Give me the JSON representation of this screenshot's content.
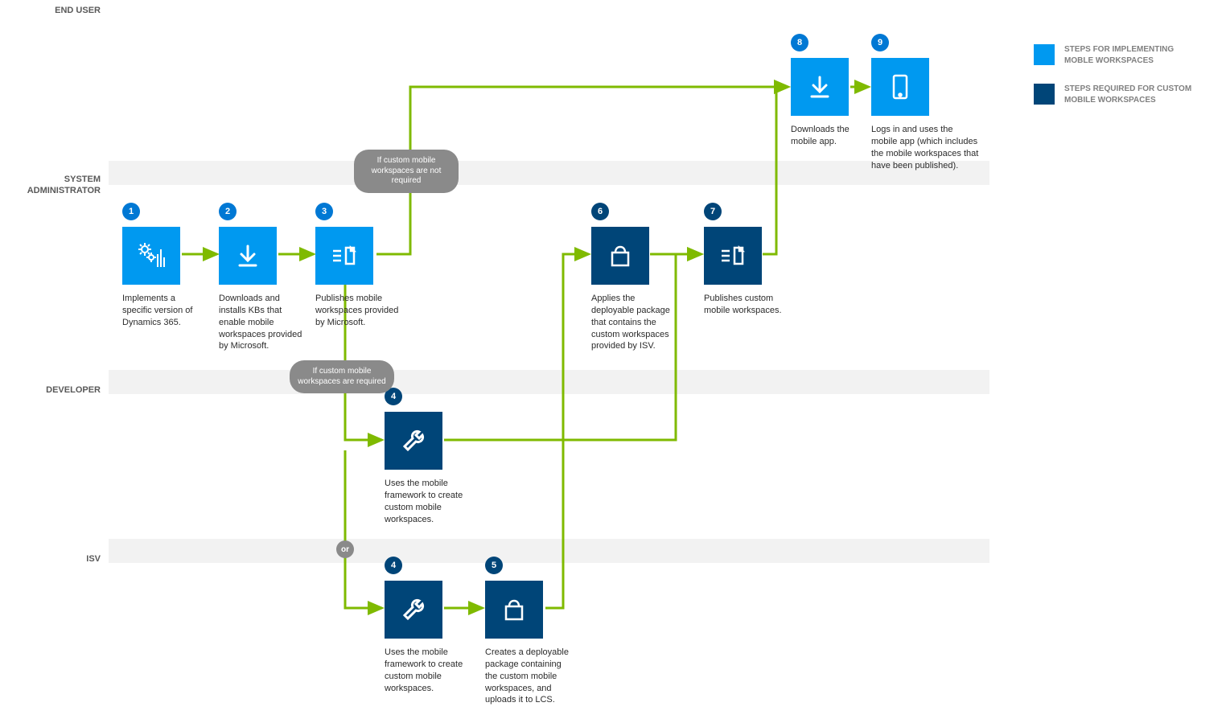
{
  "lanes": {
    "endUser": "END USER",
    "sysAdmin": "SYSTEM ADMINISTRATOR",
    "developer": "Developer",
    "isv": "ISV"
  },
  "steps": {
    "s1": {
      "n": "1",
      "d": "Implements a specific version of Dynamics 365."
    },
    "s2": {
      "n": "2",
      "d": "Downloads and installs KBs that enable mobile workspaces provided by Microsoft."
    },
    "s3": {
      "n": "3",
      "d": "Publishes mobile workspaces provided by Microsoft."
    },
    "s4a": {
      "n": "4",
      "d": "Uses the mobile framework to create custom mobile workspaces."
    },
    "s4b": {
      "n": "4",
      "d": "Uses the mobile framework to create custom mobile workspaces."
    },
    "s5": {
      "n": "5",
      "d": "Creates a deployable package containing the custom mobile workspaces, and uploads it to LCS."
    },
    "s6": {
      "n": "6",
      "d": "Applies the deployable package that contains the custom workspaces provided by ISV."
    },
    "s7": {
      "n": "7",
      "d": "Publishes custom mobile workspaces."
    },
    "s8": {
      "n": "8",
      "d": "Downloads the mobile app."
    },
    "s9": {
      "n": "9",
      "d": "Logs in and uses the mobile app (which includes the mobile workspaces that have been published)."
    }
  },
  "conditions": {
    "notRequired": "If custom mobile workspaces are not required",
    "required": "If custom mobile workspaces are required",
    "or": "or"
  },
  "legend": {
    "impl": "STEPS FOR IMPLEMENTING MOBLE WORKSPACES",
    "custom": "STEPS REQUIRED FOR CUSTOM MOBILE WORKSPACES"
  },
  "colors": {
    "green": "#7fba00",
    "light": "#0099f0",
    "dark": "#004578",
    "gray": "#8a8a8a"
  }
}
